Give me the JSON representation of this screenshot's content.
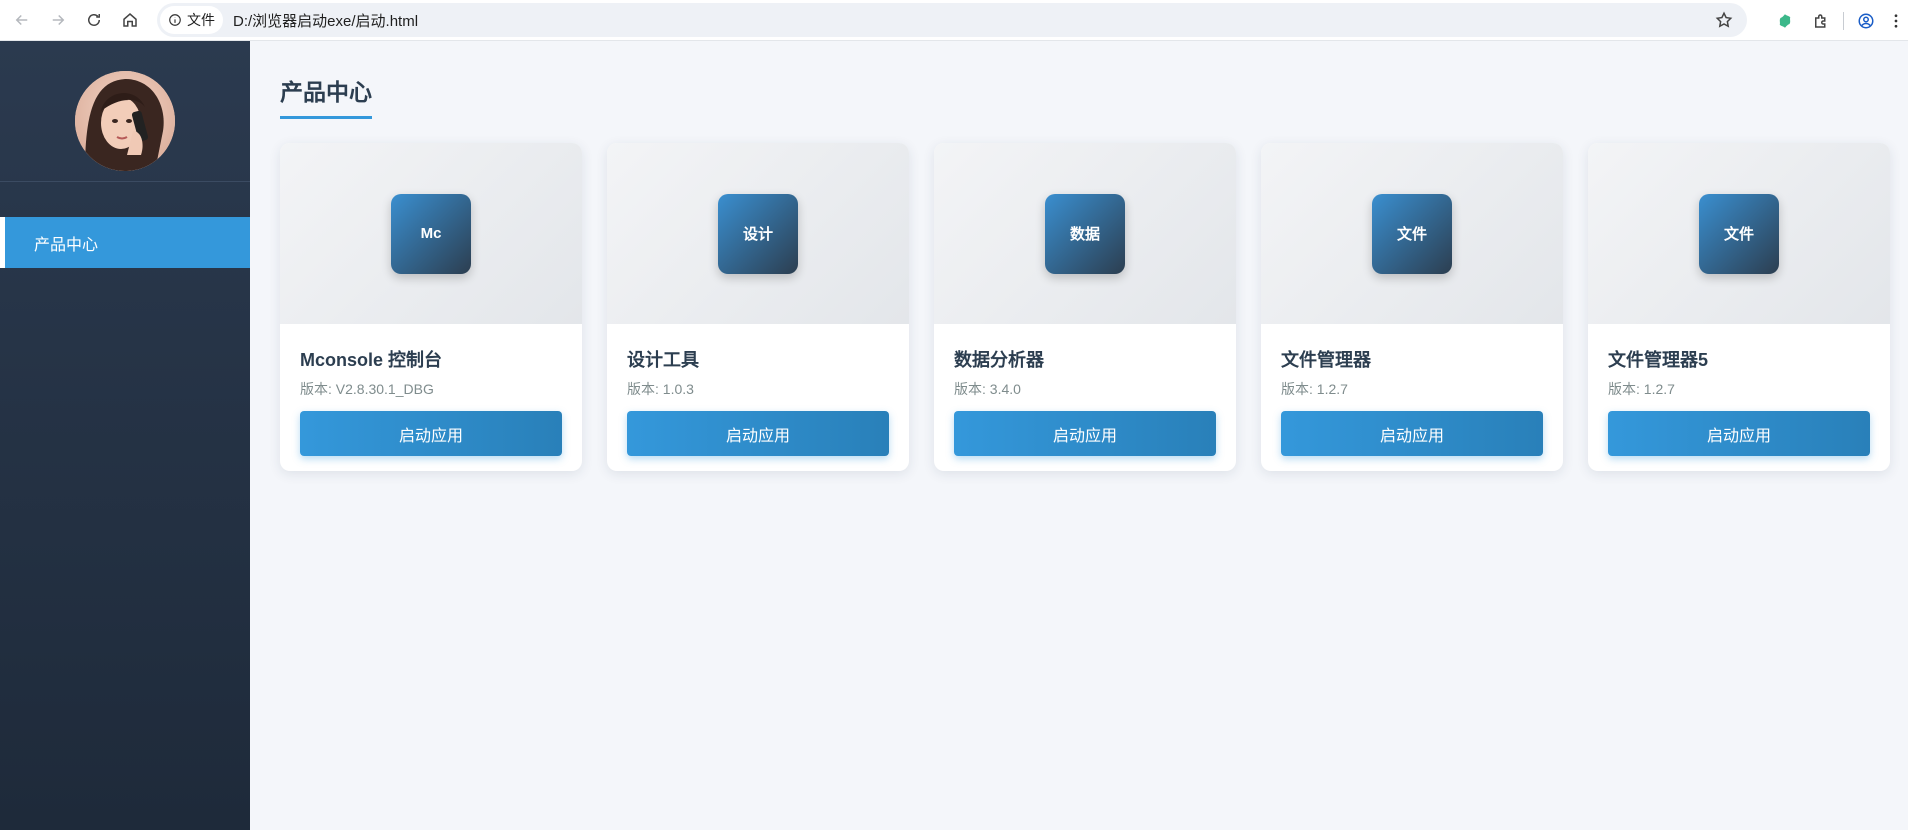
{
  "browser": {
    "site_chip_label": "文件",
    "url": "D:/浏览器启动exe/启动.html",
    "icons": [
      "back-icon",
      "forward-icon",
      "reload-icon",
      "home-icon",
      "info-icon",
      "star-icon",
      "extension-green-icon",
      "puzzle-icon",
      "profile-icon",
      "menu-dots-icon"
    ]
  },
  "sidebar": {
    "items": [
      {
        "label": "产品中心",
        "active": true
      }
    ]
  },
  "main": {
    "title": "产品中心",
    "cards": [
      {
        "icon_text": "Mc",
        "name": "Mconsole 控制台",
        "version": "版本: V2.8.30.1_DBG",
        "button": "启动应用"
      },
      {
        "icon_text": "设计",
        "name": "设计工具",
        "version": "版本: 1.0.3",
        "button": "启动应用"
      },
      {
        "icon_text": "数据",
        "name": "数据分析器",
        "version": "版本: 3.4.0",
        "button": "启动应用"
      },
      {
        "icon_text": "文件",
        "name": "文件管理器",
        "version": "版本: 1.2.7",
        "button": "启动应用"
      },
      {
        "icon_text": "文件",
        "name": "文件管理器5",
        "version": "版本: 1.2.7",
        "button": "启动应用"
      }
    ]
  },
  "colors": {
    "accent": "#3498db",
    "sidebar_top": "#2b3a4f",
    "sidebar_bottom": "#1e2a3a",
    "title_text": "#2c3e50"
  }
}
